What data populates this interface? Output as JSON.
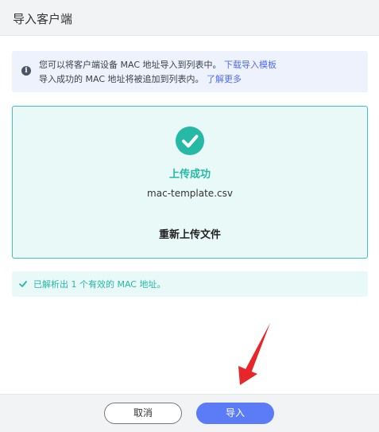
{
  "dialog": {
    "title": "导入客户端"
  },
  "info": {
    "icon": "info-icon",
    "line1_text": "您可以将客户端设备 MAC 地址导入到列表中。",
    "line1_link": "下载导入模板",
    "line2_text": "导入成功的 MAC 地址将被追加到列表内。",
    "line2_link": "了解更多"
  },
  "upload": {
    "icon": "check-circle-icon",
    "status": "上传成功",
    "file_name": "mac-template.csv",
    "reupload_label": "重新上传文件"
  },
  "result": {
    "icon": "check-icon",
    "message": "已解析出 1 个有效的 MAC 地址。"
  },
  "footer": {
    "cancel_label": "取消",
    "import_label": "导入"
  },
  "colors": {
    "accent": "#25b9a6",
    "primary": "#5b7cf6",
    "link": "#4f6ef2",
    "annotation_arrow": "#e8262a"
  }
}
